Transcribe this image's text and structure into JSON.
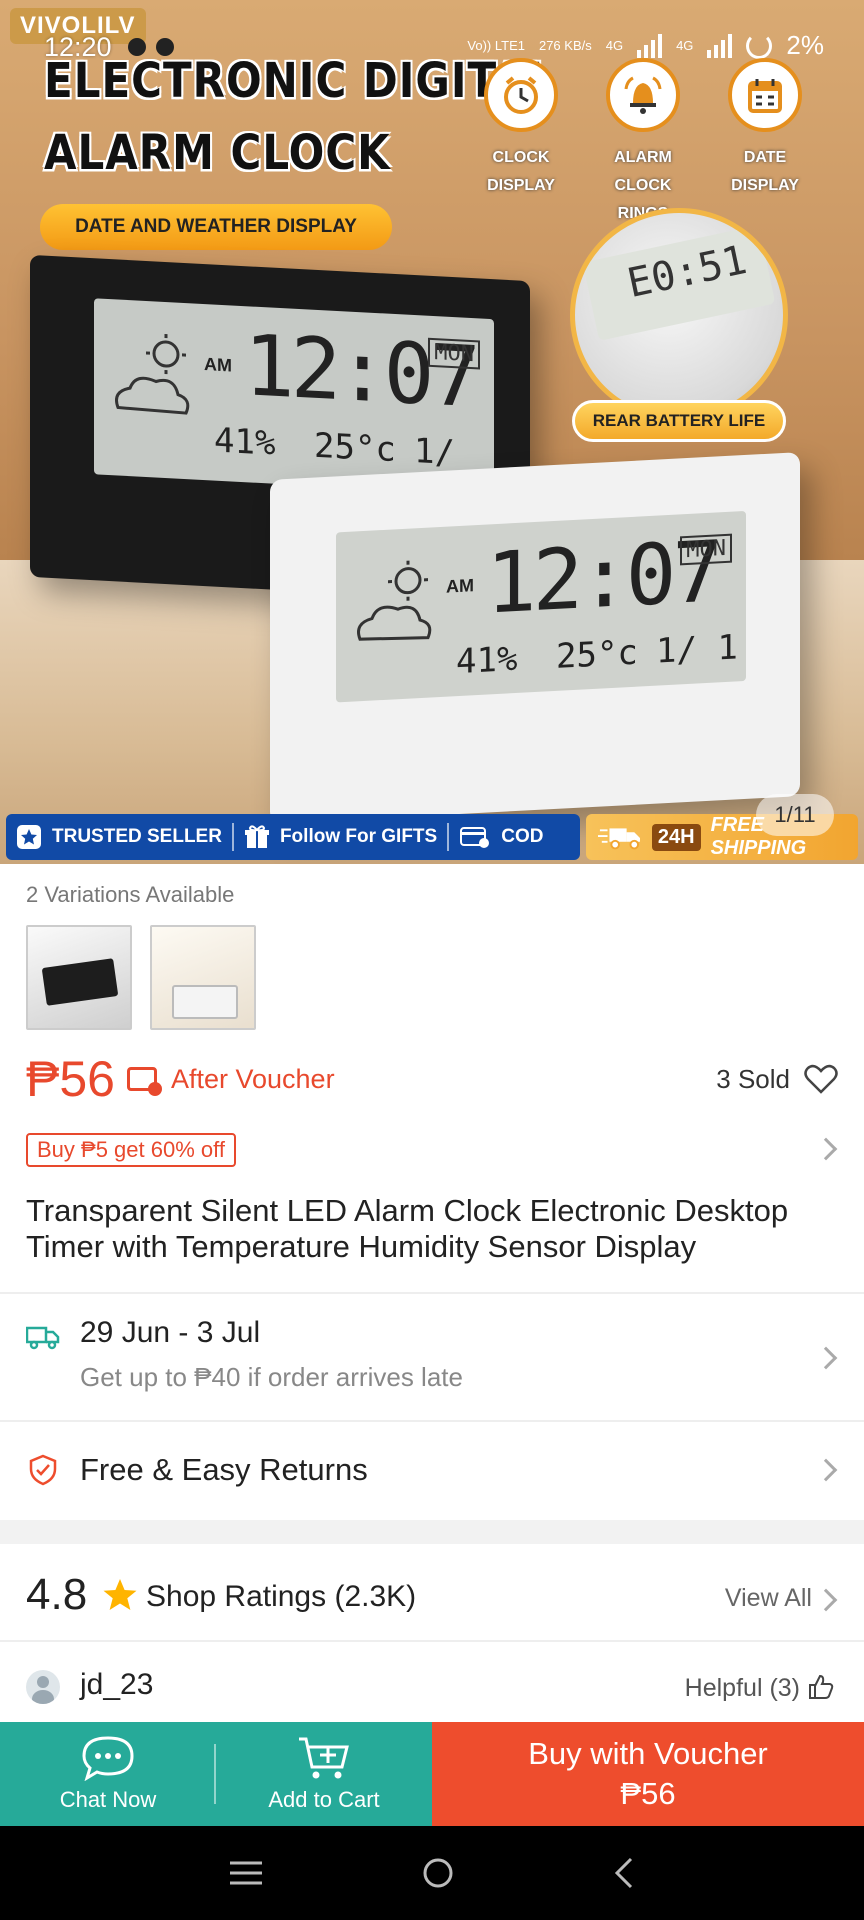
{
  "status_bar": {
    "time": "12:20",
    "battery": "2%",
    "network_labels": [
      "Vo)) LTE1",
      "276 KB/s",
      "4G",
      "4G"
    ]
  },
  "hero": {
    "watermark": "VIVOLILV",
    "title_line1": "ELECTRONIC DIGITAL",
    "title_line2": "ALARM CLOCK",
    "pill_date_weather": "DATE AND WEATHER DISPLAY",
    "features": [
      {
        "icon": "clock-icon",
        "line1": "CLOCK",
        "line2": "DISPLAY"
      },
      {
        "icon": "alarm-bell-icon",
        "line1": "ALARM",
        "line2": "CLOCK RINGS"
      },
      {
        "icon": "calendar-icon",
        "line1": "DATE",
        "line2": "DISPLAY"
      }
    ],
    "inset_time": "E0:51",
    "rear_battery": "REAR BATTERY LIFE",
    "lcd": {
      "am": "AM",
      "time": "12:07",
      "day": "MON",
      "humidity": "41%",
      "temp": "25°c",
      "date": "1/ 1"
    },
    "trust_bar": {
      "trusted_seller": "TRUSTED SELLER",
      "follow_for_gifts": "Follow For GIFTS",
      "cod": "COD",
      "h24": "24H",
      "free_shipping": "FREE SHIPPING"
    },
    "image_counter": "1/11"
  },
  "variations": {
    "label": "2 Variations Available",
    "thumbnails": [
      "variation-black",
      "variation-white"
    ]
  },
  "price": {
    "amount": "₱56",
    "after_voucher": "After Voucher",
    "sold": "3 Sold",
    "promo": "Buy ₱5 get 60% off"
  },
  "product_title": "Transparent Silent LED Alarm Clock Electronic Desktop Timer with Temperature Humidity Sensor Display",
  "shipping": {
    "dates": "29 Jun - 3 Jul",
    "late_note": "Get up to ₱40 if order arrives late"
  },
  "returns": {
    "label": "Free & Easy Returns"
  },
  "ratings": {
    "score": "4.8",
    "label": "Shop Ratings (2.3K)",
    "view_all": "View All"
  },
  "review": {
    "username": "jd_23",
    "helpful": "Helpful (3)"
  },
  "bottom_bar": {
    "chat": "Chat Now",
    "cart": "Add to Cart",
    "buy_line1": "Buy with Voucher",
    "buy_line2": "₱56"
  },
  "colors": {
    "accent": "#ee4d2d",
    "teal": "#26aa99",
    "trust_blue": "#114aa6"
  }
}
